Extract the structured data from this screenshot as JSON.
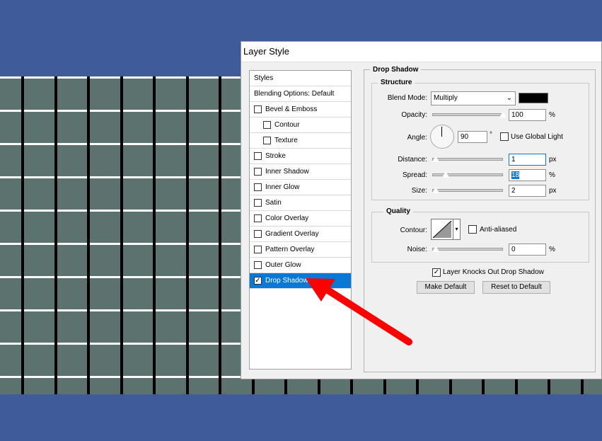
{
  "dialog": {
    "title": "Layer Style"
  },
  "styles_panel": {
    "header": "Styles",
    "items": [
      {
        "label": "Blending Options: Default",
        "checkbox": false,
        "checked": false,
        "level": 0
      },
      {
        "label": "Bevel & Emboss",
        "checkbox": true,
        "checked": false,
        "level": 1
      },
      {
        "label": "Contour",
        "checkbox": true,
        "checked": false,
        "level": 2
      },
      {
        "label": "Texture",
        "checkbox": true,
        "checked": false,
        "level": 2
      },
      {
        "label": "Stroke",
        "checkbox": true,
        "checked": false,
        "level": 1
      },
      {
        "label": "Inner Shadow",
        "checkbox": true,
        "checked": false,
        "level": 1
      },
      {
        "label": "Inner Glow",
        "checkbox": true,
        "checked": false,
        "level": 1
      },
      {
        "label": "Satin",
        "checkbox": true,
        "checked": false,
        "level": 1
      },
      {
        "label": "Color Overlay",
        "checkbox": true,
        "checked": false,
        "level": 1
      },
      {
        "label": "Gradient Overlay",
        "checkbox": true,
        "checked": false,
        "level": 1
      },
      {
        "label": "Pattern Overlay",
        "checkbox": true,
        "checked": false,
        "level": 1
      },
      {
        "label": "Outer Glow",
        "checkbox": true,
        "checked": false,
        "level": 1
      },
      {
        "label": "Drop Shadow",
        "checkbox": true,
        "checked": true,
        "level": 1,
        "selected": true
      }
    ]
  },
  "drop_shadow": {
    "title": "Drop Shadow",
    "structure": {
      "title": "Structure",
      "blend_mode_label": "Blend Mode:",
      "blend_mode_value": "Multiply",
      "shadow_color": "#000000",
      "opacity_label": "Opacity:",
      "opacity_value": "100",
      "opacity_unit": "%",
      "angle_label": "Angle:",
      "angle_value": "90",
      "angle_unit": "°",
      "use_global_light_label": "Use Global Light",
      "use_global_light_checked": false,
      "distance_label": "Distance:",
      "distance_value": "1",
      "distance_unit": "px",
      "spread_label": "Spread:",
      "spread_value": "18",
      "spread_unit": "%",
      "size_label": "Size:",
      "size_value": "2",
      "size_unit": "px"
    },
    "quality": {
      "title": "Quality",
      "contour_label": "Contour:",
      "anti_aliased_label": "Anti-aliased",
      "anti_aliased_checked": false,
      "noise_label": "Noise:",
      "noise_value": "0",
      "noise_unit": "%"
    },
    "knocks_out_label": "Layer Knocks Out Drop Shadow",
    "knocks_out_checked": true,
    "make_default_label": "Make Default",
    "reset_default_label": "Reset to Default"
  },
  "colors": {
    "background": "#3f5b99",
    "tile": "#5b726e",
    "selection": "#0a78d7",
    "arrow": "#ff0000"
  },
  "icons": {
    "check": "✓",
    "dropdown": "chevron-down-icon",
    "annotation": "red-arrow-icon"
  }
}
